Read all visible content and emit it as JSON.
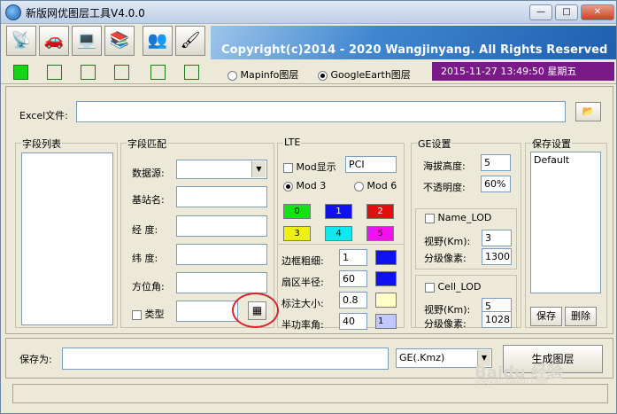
{
  "window": {
    "title": "新版网优图层工具V4.0.0"
  },
  "banner": {
    "text": "Copyright(c)2014 - 2020 Wangjinyang. All Rights Reserved"
  },
  "toolbar": {
    "icons": [
      "antenna-icon",
      "car-signal-icon",
      "laptop-icon",
      "books-icon",
      "users-icon",
      "brush-icon"
    ]
  },
  "status": {
    "lamps_on": 1,
    "map_mapinfo": "Mapinfo图层",
    "map_googleearth": "GoogleEarth图层",
    "datetime": "2015-11-27 13:49:50  星期五"
  },
  "excel": {
    "label": "Excel文件:",
    "value": ""
  },
  "fieldlist": {
    "title": "字段列表"
  },
  "fieldmatch": {
    "title": "字段匹配",
    "datasource": "数据源:",
    "bsname": "基站名:",
    "longitude": "经  度:",
    "latitude": "纬  度:",
    "azimuth": "方位角:",
    "type": "类型"
  },
  "lte": {
    "title": "LTE",
    "mod_show": "Mod显示",
    "pci_value": "PCI",
    "mod3": "Mod 3",
    "mod6": "Mod 6",
    "swatches": [
      {
        "label": "0",
        "color": "#18e018"
      },
      {
        "label": "1",
        "color": "#1010f0"
      },
      {
        "label": "2",
        "color": "#e01010"
      },
      {
        "label": "3",
        "color": "#f0f010"
      },
      {
        "label": "4",
        "color": "#10e8f0"
      },
      {
        "label": "5",
        "color": "#f010f0"
      }
    ],
    "border_width_label": "边框粗细:",
    "border_width": "1",
    "sector_radius_label": "扇区半径:",
    "sector_radius": "60",
    "label_size_label": "标注大小:",
    "label_size": "0.8",
    "half_power_label": "半功率角:",
    "half_power": "40",
    "half_power_swatch": "1"
  },
  "ge": {
    "title": "GE设置",
    "altitude_label": "海拔高度:",
    "altitude": "5",
    "opacity_label": "不透明度:",
    "opacity": "60%",
    "name_lod": "Name_LOD",
    "view_label": "视野(Km):",
    "name_view": "3",
    "pixel_label": "分级像素:",
    "name_pixel": "1300",
    "cell_lod": "Cell_LOD",
    "cell_view": "5",
    "cell_pixel": "1028"
  },
  "savesettings": {
    "title": "保存设置",
    "items": [
      "Default"
    ],
    "save": "保存",
    "delete": "删除"
  },
  "output": {
    "save_as_label": "保存为:",
    "path": "",
    "format": "GE(.Kmz)",
    "generate": "生成图层"
  },
  "watermark": {
    "text": "Baidu 经验",
    "sub": "jingyan.baidu.com"
  }
}
